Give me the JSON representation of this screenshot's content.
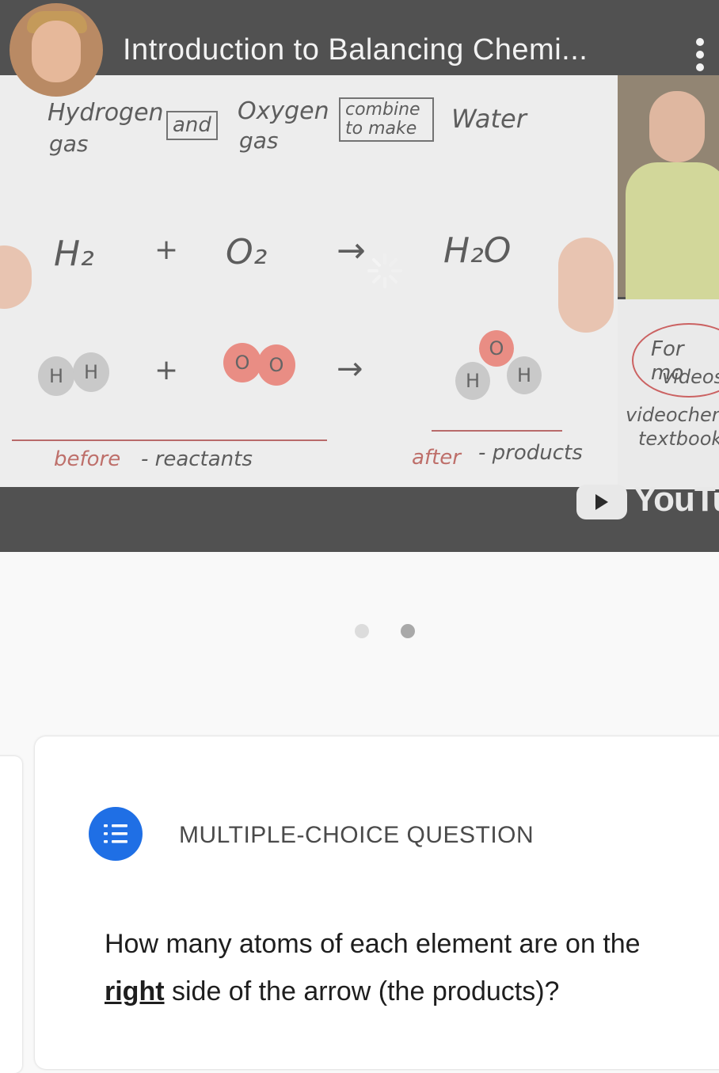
{
  "video": {
    "title": "Introduction to Balancing Chemi...",
    "board": {
      "top_words": [
        "Hydrogen",
        "gas",
        "and",
        "Oxygen",
        "gas",
        "combine",
        "to make",
        "Water"
      ],
      "equation": {
        "left1": "H₂",
        "plus": "+",
        "left2": "O₂",
        "arrow": "→",
        "right": "H₂O"
      },
      "atoms": {
        "h": "H",
        "o": "O"
      },
      "before_label": "before",
      "reactants_label": "- reactants",
      "after_label": "after",
      "products_label": "- products"
    },
    "side_card": {
      "line1": "For mo",
      "line2": "videos",
      "line3": "videochen",
      "line4": "textbook"
    },
    "brand": "YouTub"
  },
  "pager": {
    "count": 2,
    "active_index": 1
  },
  "question": {
    "type_label": "MULTIPLE-CHOICE QUESTION",
    "text_part1": "How many atoms of each element are on the ",
    "emphasis": "right",
    "text_part2": " side of the arrow (the products)?"
  },
  "colors": {
    "accent": "#1f6fe5",
    "video_bg": "#2b2b2b",
    "atom_o": "#e5746a",
    "atom_h": "#bdbdbd"
  }
}
